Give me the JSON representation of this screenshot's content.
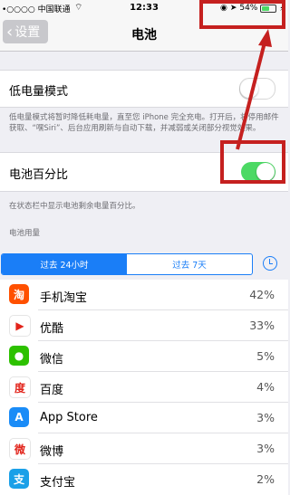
{
  "status_bar": {
    "carrier": "•○○○○ 中国联通",
    "time": "12:33",
    "battery_percent": "54%",
    "battery_level": 0.54
  },
  "nav": {
    "back_label": "设置",
    "title": "电池"
  },
  "low_power": {
    "label": "低电量模式",
    "enabled": false,
    "footer": "低电量模式将暂时降低耗电量，直至您 iPhone 完全充电。打开后，将停用邮件获取、“嘿Siri”、后台应用刷新与自动下载，并减弱或关闭部分视觉效果。"
  },
  "battery_percentage": {
    "label": "电池百分比",
    "enabled": true,
    "footer": "在状态栏中显示电池剩余电量百分比。"
  },
  "usage": {
    "section_header": "电池用量",
    "tabs": [
      "过去 24小时",
      "过去 7天"
    ],
    "selected_tab": 0,
    "apps": [
      {
        "name": "手机淘宝",
        "percent": "42%",
        "icon": "taobao-icon",
        "color": "#ff5000",
        "glyph": "淘"
      },
      {
        "name": "优酷",
        "percent": "33%",
        "icon": "youku-icon",
        "color": "#ffffff",
        "glyph": "▶"
      },
      {
        "name": "微信",
        "percent": "5%",
        "icon": "wechat-icon",
        "color": "#2dc100",
        "glyph": "●"
      },
      {
        "name": "百度",
        "percent": "4%",
        "icon": "baidu-icon",
        "color": "#ffffff",
        "glyph": "度"
      },
      {
        "name": "App Store",
        "percent": "3%",
        "icon": "app-store-icon",
        "color": "#1a8cf7",
        "glyph": "A"
      },
      {
        "name": "微博",
        "percent": "3%",
        "icon": "weibo-icon",
        "color": "#ffffff",
        "glyph": "微"
      },
      {
        "name": "支付宝",
        "percent": "2%",
        "icon": "alipay-icon",
        "color": "#1aa0e8",
        "glyph": "支"
      }
    ]
  },
  "annotation_color": "#c5201f",
  "toggle_on_color": "#4cd964",
  "accent_color": "#1a7ef7"
}
